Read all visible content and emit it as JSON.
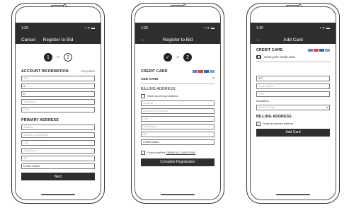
{
  "phones": [
    {
      "status_time": "1:29",
      "status_icons": "▪ ᯤ ▬",
      "nav_left": "Cancel",
      "title": "Register to Bid",
      "steps": [
        "1",
        ">",
        "2"
      ],
      "section": "ACCOUNT INFORMATION",
      "required": "* REQUIRED",
      "account_fields": [
        {
          "placeholder": "Title",
          "value": ""
        },
        {
          "placeholder": "",
          "value": "A"
        },
        {
          "placeholder": "",
          "value": "D"
        },
        {
          "placeholder": "Telephone",
          "value": ""
        },
        {
          "placeholder": "DOB",
          "value": ""
        }
      ],
      "address_title": "PRIMARY ADDRESS",
      "address_fields": [
        "Address",
        "Address 2 (Optional)",
        "City",
        "State/Zone",
        "ZIP"
      ],
      "country": "United States",
      "button": "Next"
    },
    {
      "status_time": "1:30",
      "status_icons": "▪ ᯤ ▬",
      "nav_left": "←",
      "title": "Register to Bid",
      "steps": [
        "✓",
        ">",
        "2"
      ],
      "credit_card": "CREDIT CARD",
      "add_card": "ADD CARD",
      "add_card_arrow": ">",
      "billing": "BILLING ADDRESS",
      "same_as_primary": "Same as primary address",
      "address_fields": [
        "Address",
        "Address 2 (Optional)",
        "City",
        "State/Zone",
        "ZIP"
      ],
      "country": "United States",
      "terms_prefix": "I have read the ",
      "terms_link": "TERMS & CONDITIONS",
      "button": "Complete Registration"
    },
    {
      "status_time": "1:30",
      "status_icons": "▪ ᯤ ▬",
      "nav_left": "←",
      "title": "Add Card",
      "credit_card": "CREDIT CARD",
      "scan": "Scan your credit card",
      "fields": [
        {
          "placeholder": "",
          "value": "A D"
        },
        {
          "placeholder": "Card Number",
          "value": ""
        },
        {
          "placeholder": "CVV",
          "value": ""
        }
      ],
      "expiration_label": "Expiration",
      "expiration_value": "Month of Year",
      "billing": "BILLING ADDRESS",
      "same_as_primary": "Same as primary address",
      "button": "Add Card",
      "card_colors": [
        "#6b7fb4",
        "#d64545",
        "#2a6fb0",
        "#8aa0c9"
      ]
    }
  ]
}
